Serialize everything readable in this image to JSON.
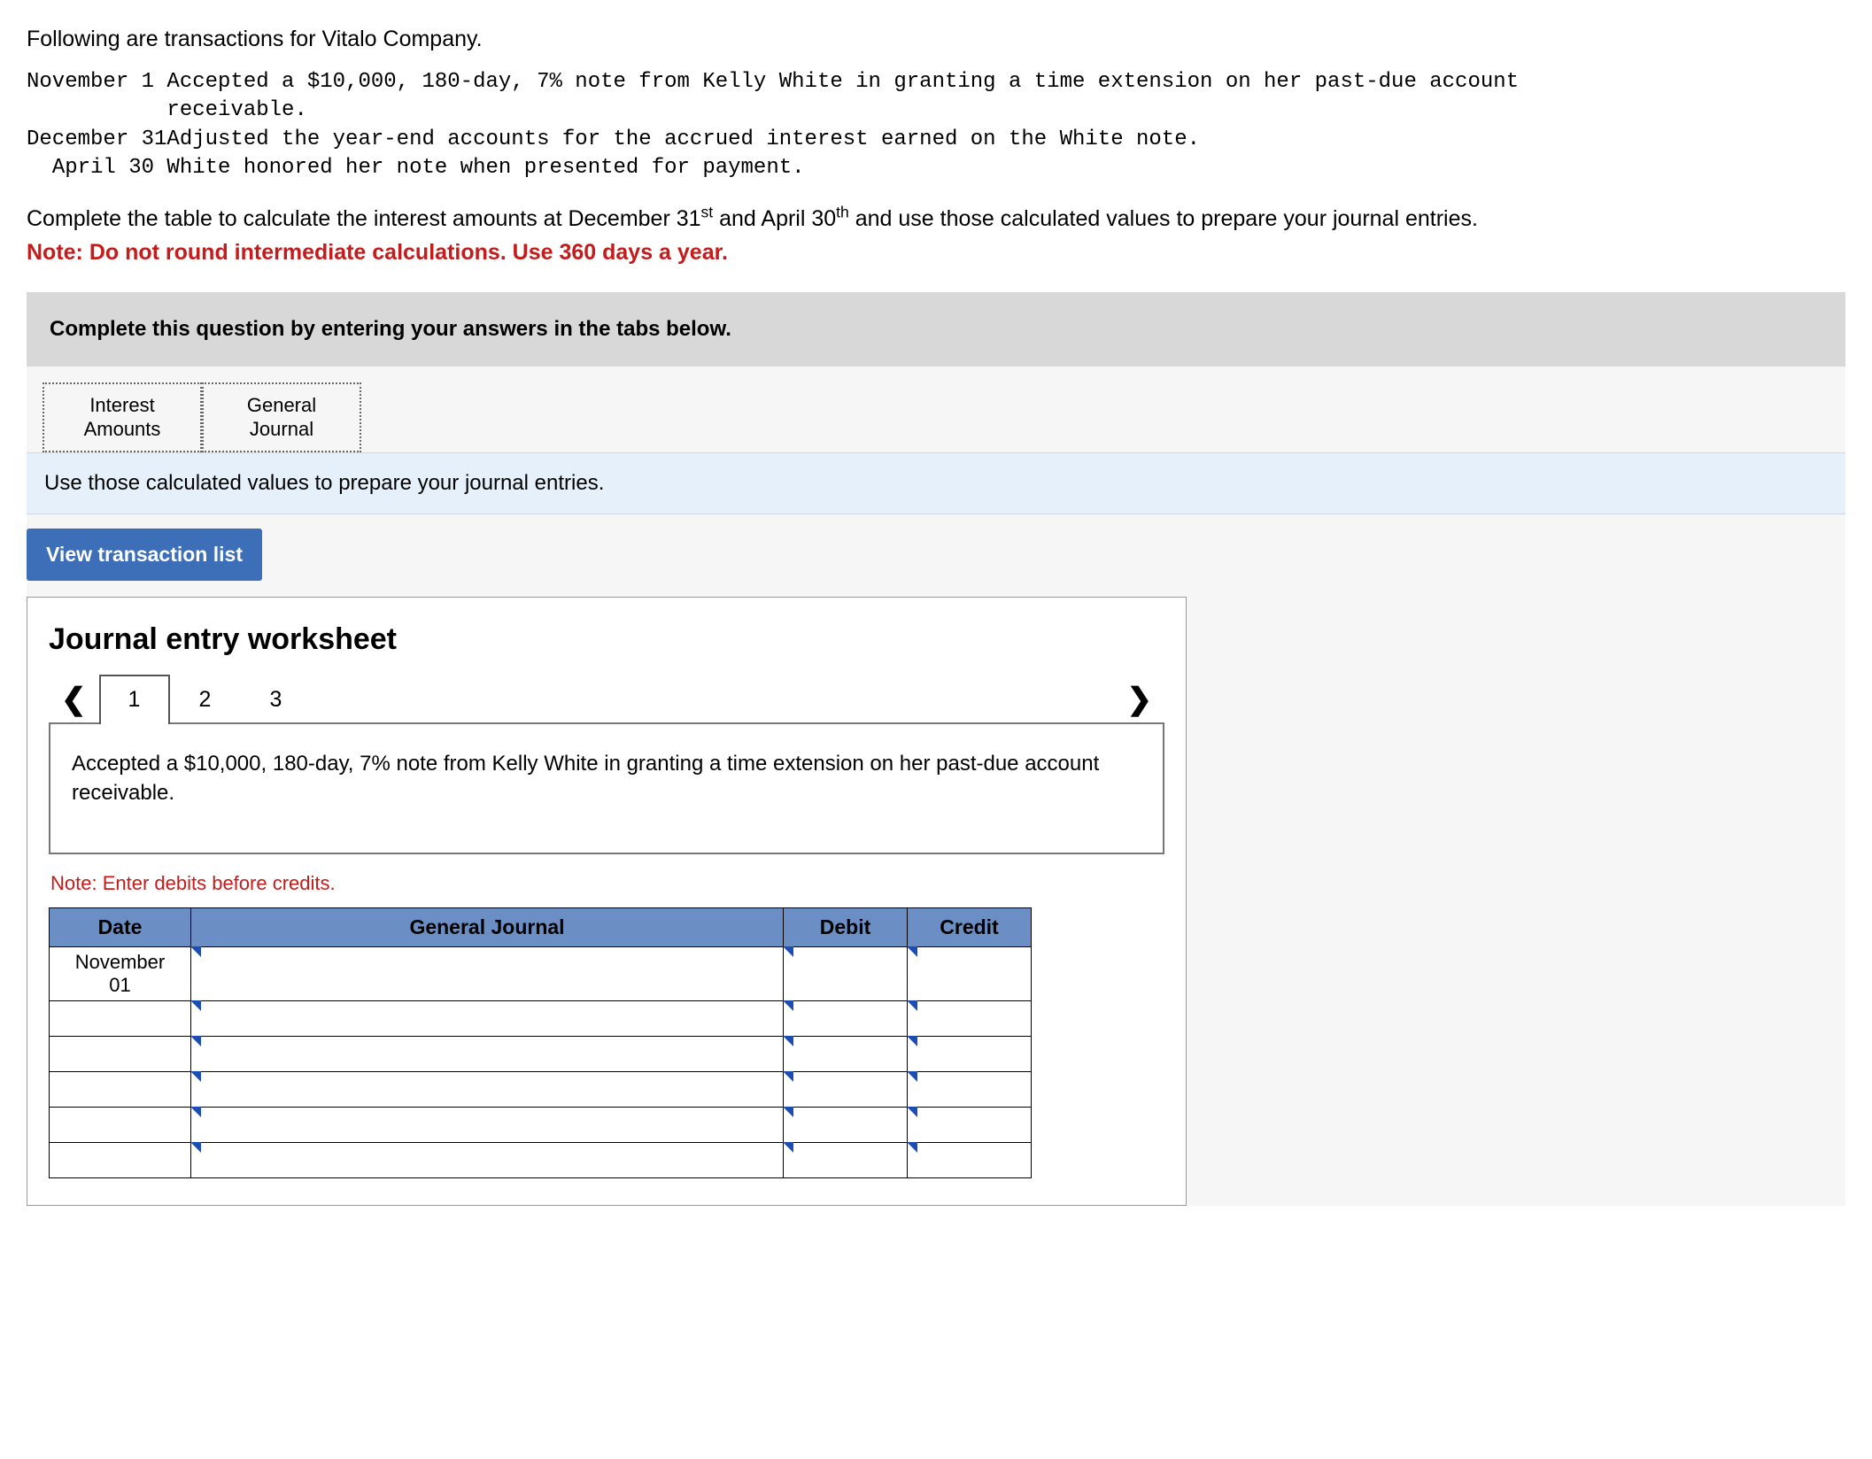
{
  "intro": "Following are transactions for Vitalo Company.",
  "transactions": [
    {
      "date": "November 1",
      "text_l1": "Accepted a $10,000, 180-day, 7% note from Kelly White in granting a time extension on her past-due account",
      "text_l2": "receivable."
    },
    {
      "date": "December 31",
      "text_l1": "Adjusted the year-end accounts for the accrued interest earned on the White note.",
      "text_l2": ""
    },
    {
      "date": "April 30",
      "text_l1": "White honored her note when presented for payment.",
      "text_l2": ""
    }
  ],
  "prompt_before_sup1": "Complete the table to calculate the interest amounts at December 31",
  "sup1": "st",
  "prompt_mid": " and April 30",
  "sup2": "th",
  "prompt_after": " and use those calculated values to prepare your journal entries.",
  "red_note": "Note: Do not round intermediate calculations. Use 360 days a year.",
  "banner": "Complete this question by entering your answers in the tabs below.",
  "tabs": {
    "interest": {
      "line1": "Interest",
      "line2": "Amounts"
    },
    "general": {
      "line1": "General",
      "line2": "Journal"
    }
  },
  "sub_instruction": "Use those calculated values to prepare your journal entries.",
  "view_btn": "View transaction list",
  "ws_title": "Journal entry worksheet",
  "pages": [
    "1",
    "2",
    "3"
  ],
  "entry_description": "Accepted a $10,000, 180-day, 7% note from Kelly White in granting a time extension on her past-due account receivable.",
  "debit_note": "Note: Enter debits before credits.",
  "table": {
    "headers": {
      "date": "Date",
      "gj": "General Journal",
      "debit": "Debit",
      "credit": "Credit"
    },
    "first_date": {
      "l1": "November",
      "l2": "01"
    }
  }
}
